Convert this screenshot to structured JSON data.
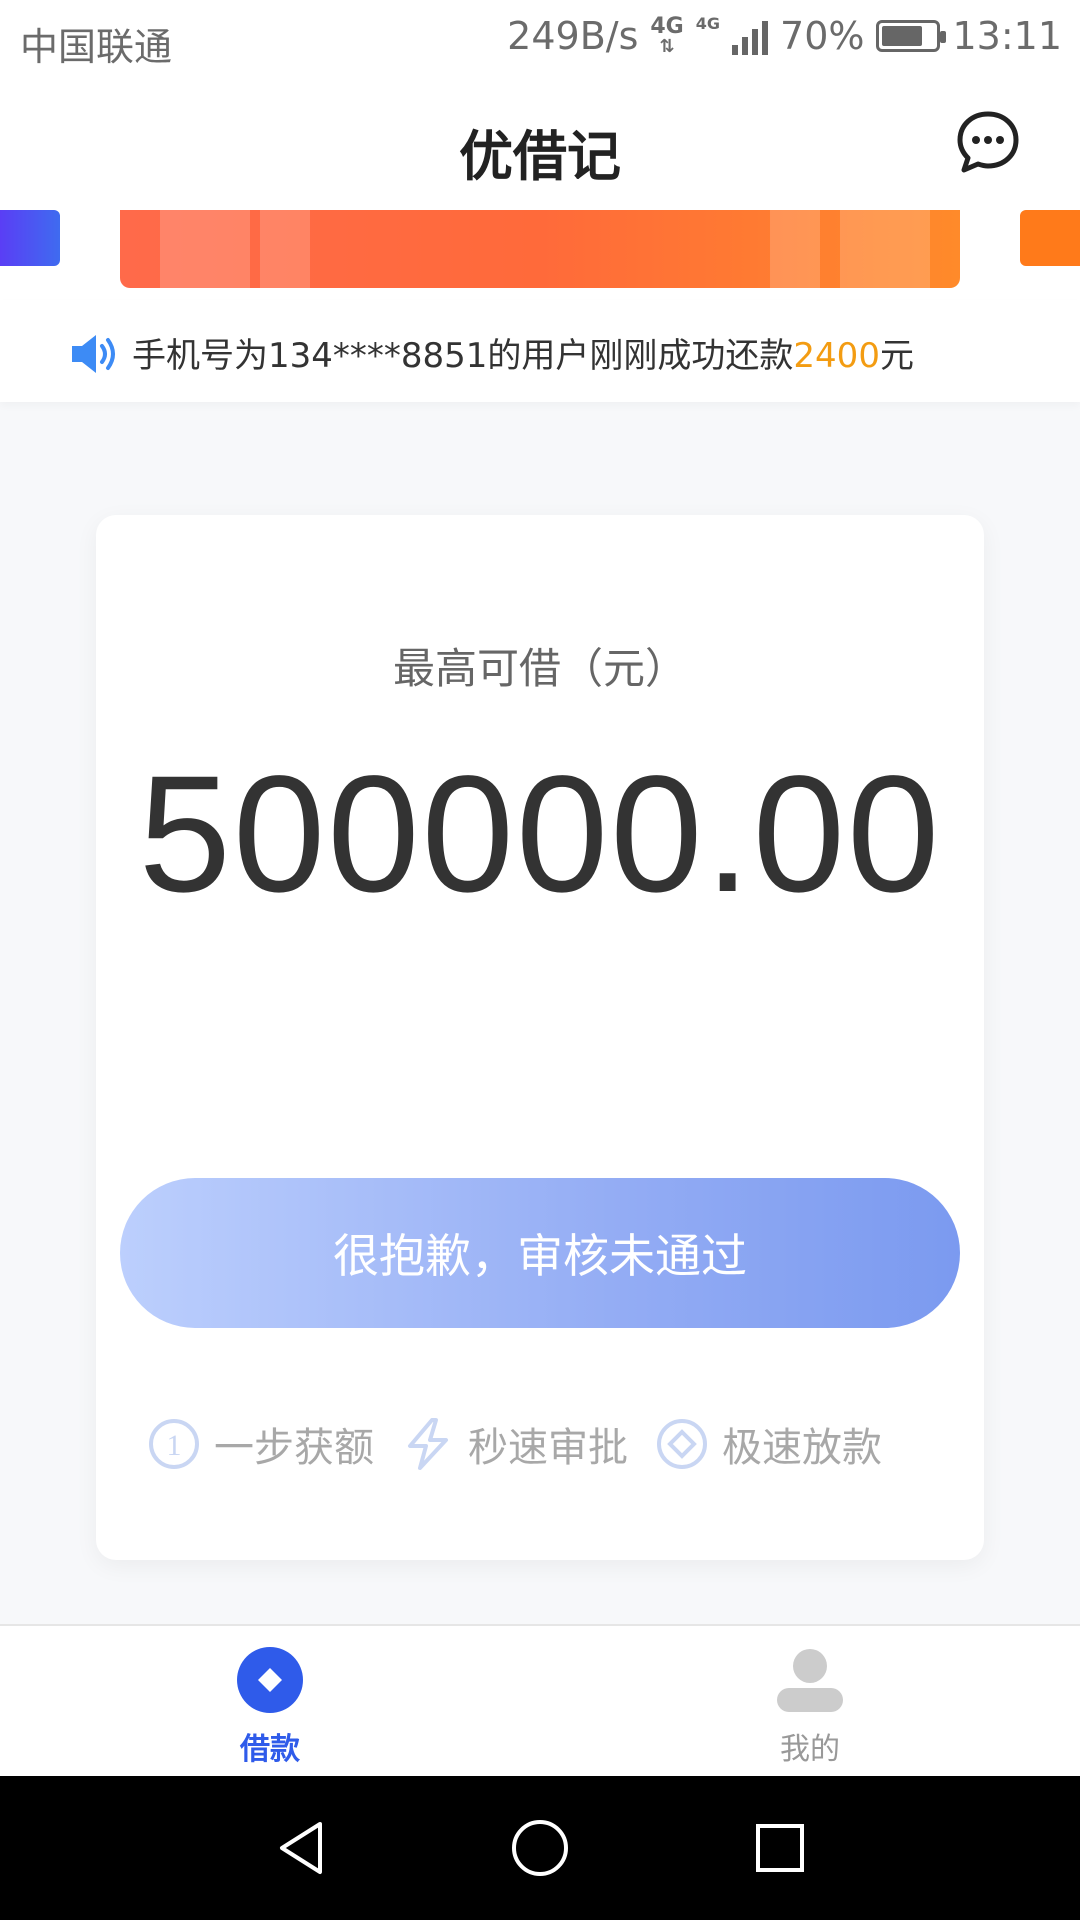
{
  "status_bar": {
    "carrier": "中国联通",
    "net_speed": "249B/s",
    "network_type": "4G",
    "network_type_small": "4G",
    "battery": "70%",
    "time": "13:11"
  },
  "header": {
    "title": "优借记",
    "chat_icon": "chat-bubble-icon"
  },
  "notice": {
    "icon": "speaker-icon",
    "text_prefix": "手机号为134****8851的用户刚刚成功还款",
    "amount": "2400",
    "text_suffix": "元"
  },
  "card": {
    "label": "最高可借（元）",
    "amount": "500000.00",
    "button_label": "很抱歉，审核未通过",
    "features": [
      {
        "icon": "number-one-icon",
        "label": "一步获额"
      },
      {
        "icon": "lightning-icon",
        "label": "秒速审批"
      },
      {
        "icon": "diamond-icon",
        "label": "极速放款"
      }
    ]
  },
  "bottom_nav": {
    "items": [
      {
        "icon": "loan-icon",
        "label": "借款",
        "active": true
      },
      {
        "icon": "user-icon",
        "label": "我的",
        "active": false
      }
    ]
  },
  "colors": {
    "accent": "#2f5bea",
    "button_gradient_start": "#bccffd",
    "button_gradient_end": "#7b9af0",
    "highlight": "#f39c12"
  }
}
